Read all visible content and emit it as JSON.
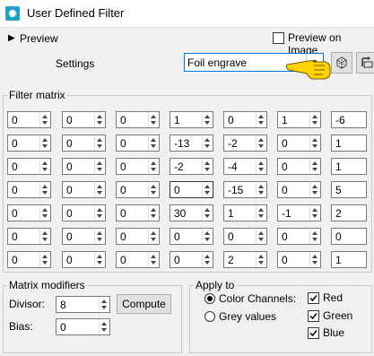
{
  "window": {
    "title": "User Defined Filter"
  },
  "preview": {
    "label": "Preview",
    "preview_on_image_label": "Preview on Image",
    "preview_on_image_checked": false
  },
  "settings": {
    "label": "Settings",
    "preset_value": "Foil engrave"
  },
  "filter_matrix": {
    "title": "Filter matrix",
    "rows": [
      [
        "0",
        "0",
        "0",
        "1",
        "0",
        "1",
        "-6"
      ],
      [
        "0",
        "0",
        "0",
        "-13",
        "-2",
        "0",
        "1"
      ],
      [
        "0",
        "0",
        "0",
        "-2",
        "-4",
        "0",
        "1"
      ],
      [
        "0",
        "0",
        "0",
        "0",
        "-15",
        "0",
        "5"
      ],
      [
        "0",
        "0",
        "0",
        "30",
        "1",
        "-1",
        "2"
      ],
      [
        "0",
        "0",
        "0",
        "0",
        "0",
        "0",
        "0"
      ],
      [
        "0",
        "0",
        "0",
        "0",
        "2",
        "0",
        "1"
      ]
    ]
  },
  "matrix_modifiers": {
    "title": "Matrix modifiers",
    "divisor_label": "Divisor:",
    "divisor_value": "8",
    "compute_label": "Compute",
    "bias_label": "Bias:",
    "bias_value": "0"
  },
  "apply_to": {
    "title": "Apply to",
    "color_channels_label": "Color Channels:",
    "grey_values_label": "Grey values",
    "selected": "color_channels",
    "red_label": "Red",
    "green_label": "Green",
    "blue_label": "Blue",
    "red_checked": true,
    "green_checked": true,
    "blue_checked": true
  },
  "icons": [
    "app-icon",
    "expand-arrow-icon",
    "pointing-hand-icon",
    "dice-icon",
    "reset-icon",
    "dropdown-icon"
  ],
  "colors": {
    "accent": "#0078d7",
    "app_icon": "#1ea3c8",
    "hand": "#ffd200"
  }
}
